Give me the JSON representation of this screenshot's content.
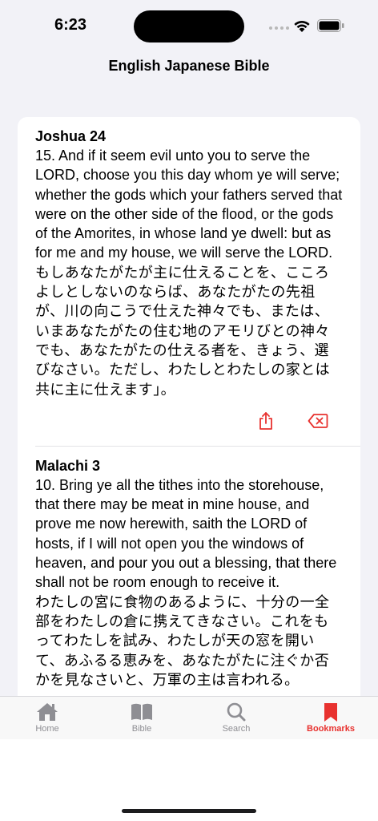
{
  "status": {
    "time": "6:23"
  },
  "header": {
    "title": "English Japanese Bible"
  },
  "bookmarks": [
    {
      "reference": "Joshua 24",
      "english": "15. And if it seem evil unto you to serve the LORD, choose you this day whom ye will serve; whether the gods which your fathers served that were on the other side of the flood, or the gods of the Amorites, in whose land ye dwell: but as for me and my house, we will serve the LORD.",
      "japanese": "もしあなたがたが主に仕えることを、こころよしとしないのならば、あなたがたの先祖が、川の向こうで仕えた神々でも、または、いまあなたがたの住む地のアモリびとの神々でも、あなたがたの仕える者を、きょう、選びなさい。ただし、わたしとわたしの家とは共に主に仕えます」。"
    },
    {
      "reference": "Malachi 3",
      "english": "10. Bring ye all the tithes into the storehouse, that there may be meat in mine house, and prove me now herewith, saith the LORD of hosts, if I will not open you the windows of heaven, and pour you out a blessing, that there shall not be room enough to receive it.",
      "japanese": "わたしの宮に食物のあるように、十分の一全部をわたしの倉に携えてきなさい。これをもってわたしを試み、わたしが天の窓を開いて、あふるる恵みを、あなたがたに注ぐか否かを見なさいと、万軍の主は言われる。"
    }
  ],
  "tabs": [
    {
      "label": "Home",
      "icon": "home-icon"
    },
    {
      "label": "Bible",
      "icon": "book-icon"
    },
    {
      "label": "Search",
      "icon": "search-icon"
    },
    {
      "label": "Bookmarks",
      "icon": "bookmark-icon"
    }
  ],
  "colors": {
    "accent": "#e8322f",
    "inactive": "#8e8e93"
  }
}
